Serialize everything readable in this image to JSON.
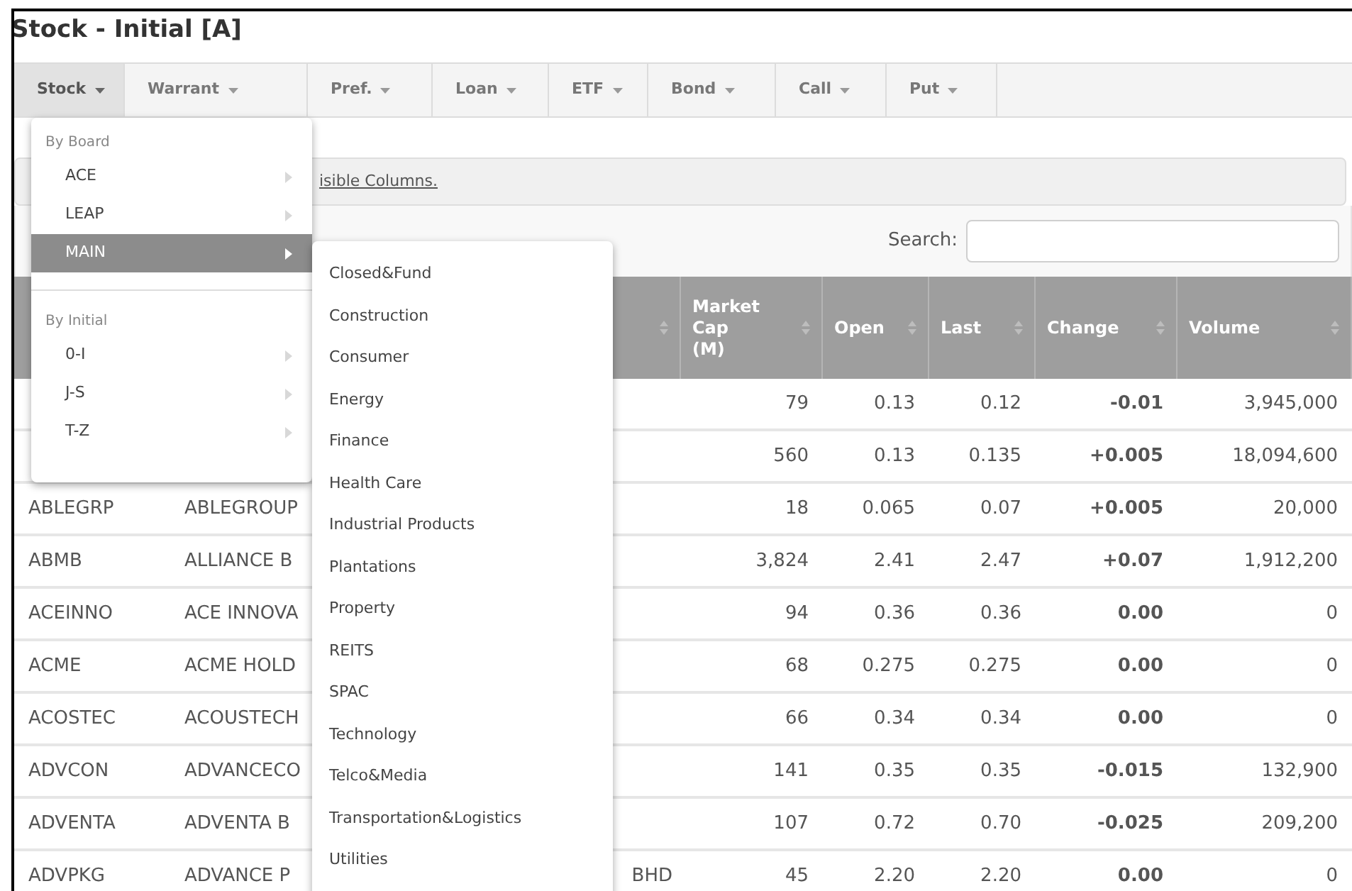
{
  "title": "Stock - Initial [A]",
  "tabs": [
    {
      "label": "Stock",
      "selected": true
    },
    {
      "label": "Warrant",
      "selected": false
    },
    {
      "label": "Pref.",
      "selected": false
    },
    {
      "label": "Loan",
      "selected": false
    },
    {
      "label": "ETF",
      "selected": false
    },
    {
      "label": "Bond",
      "selected": false
    },
    {
      "label": "Call",
      "selected": false
    },
    {
      "label": "Put",
      "selected": false
    }
  ],
  "toolbar": {
    "link": "isible Columns."
  },
  "search": {
    "label": "Search:"
  },
  "table": {
    "columns": [
      "Market Cap (M)",
      "Open",
      "Last",
      "Change",
      "Volume"
    ],
    "rows": [
      {
        "cells": [
          "79",
          "0.13",
          "0.12",
          "-0.01",
          "3,945,000"
        ]
      },
      {
        "cells": [
          "560",
          "0.13",
          "0.135",
          "+0.005",
          "18,094,600"
        ]
      },
      {
        "code": "ABLEGRP",
        "name": "ABLEGROUP",
        "cells": [
          "18",
          "0.065",
          "0.07",
          "+0.005",
          "20,000"
        ]
      },
      {
        "code": "ABMB",
        "name": "ALLIANCE B",
        "cells": [
          "3,824",
          "2.41",
          "2.47",
          "+0.07",
          "1,912,200"
        ]
      },
      {
        "code": "ACEINNO",
        "name": "ACE INNOVA",
        "cells": [
          "94",
          "0.36",
          "0.36",
          "0.00",
          "0"
        ]
      },
      {
        "code": "ACME",
        "name": "ACME HOLD",
        "cells": [
          "68",
          "0.275",
          "0.275",
          "0.00",
          "0"
        ]
      },
      {
        "code": "ACOSTEC",
        "name": "ACOUSTECH",
        "cells": [
          "66",
          "0.34",
          "0.34",
          "0.00",
          "0"
        ]
      },
      {
        "code": "ADVCON",
        "name": "ADVANCECO",
        "cells": [
          "141",
          "0.35",
          "0.35",
          "-0.015",
          "132,900"
        ]
      },
      {
        "code": "ADVENTA",
        "name": "ADVENTA B",
        "cells": [
          "107",
          "0.72",
          "0.70",
          "-0.025",
          "209,200"
        ]
      },
      {
        "code": "ADVPKG",
        "name": "ADVANCE P",
        "name_tail": "BHD",
        "cells": [
          "45",
          "2.20",
          "2.20",
          "0.00",
          "0"
        ]
      }
    ]
  },
  "menu": {
    "sections": [
      {
        "heading": "By Board",
        "items": [
          {
            "label": "ACE",
            "selected": false
          },
          {
            "label": "LEAP",
            "selected": false
          },
          {
            "label": "MAIN",
            "selected": true
          }
        ]
      },
      {
        "heading": "By Initial",
        "items": [
          {
            "label": "0-I",
            "selected": false
          },
          {
            "label": "J-S",
            "selected": false
          },
          {
            "label": "T-Z",
            "selected": false
          }
        ]
      }
    ]
  },
  "submenu": {
    "items": [
      "Closed&Fund",
      "Construction",
      "Consumer",
      "Energy",
      "Finance",
      "Health Care",
      "Industrial Products",
      "Plantations",
      "Property",
      "REITS",
      "SPAC",
      "Technology",
      "Telco&Media",
      "Transportation&Logistics",
      "Utilities"
    ]
  }
}
